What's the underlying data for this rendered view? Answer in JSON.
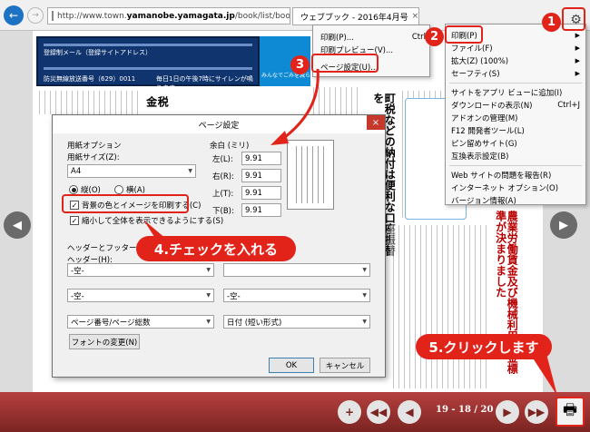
{
  "browser": {
    "url_prefix": "http://www.town.",
    "url_host": "yamanobe.yamagata.jp",
    "url_suffix": "/book/list/book19.",
    "tab_title": "ウェブブック - 2016年4月号",
    "tab_close": "×",
    "icons": [
      "back-arrow-icon",
      "forward-arrow-icon",
      "page-icon",
      "refresh-icon",
      "gear-icon"
    ]
  },
  "document": {
    "header_text1": "登録制メール（登録サイトアドレス）",
    "header_text2": "防災無線放送番号（629）0011",
    "header_text3": "毎日1日の午後7時にサイレンが鳴ります",
    "header_text4": "みんなでごみを減らしましょう！",
    "vertical_title": "町税などの納付は便利な口座振替を",
    "vertical_red": "農業労働賃金及び機械利用料金標準が決まりました",
    "side_text": "税金"
  },
  "print_menu": {
    "print": "印刷(P)...",
    "print_shortcut": "Ctrl",
    "preview": "印刷プレビュー(V)...",
    "page_setup": "ページ設定(U)..."
  },
  "gear_menu": {
    "items": [
      {
        "label": "印刷(P)",
        "shortcut": "",
        "submenu": true
      },
      {
        "label": "ファイル(F)",
        "shortcut": "",
        "submenu": true
      },
      {
        "label": "拡大(Z) (100%)",
        "shortcut": "",
        "submenu": true
      },
      {
        "label": "セーフティ(S)",
        "shortcut": "",
        "submenu": true
      },
      {
        "label": "サイトをアプリ ビューに追加(I)",
        "shortcut": "",
        "submenu": false
      },
      {
        "label": "ダウンロードの表示(N)",
        "shortcut": "Ctrl+J",
        "submenu": false
      },
      {
        "label": "アドオンの管理(M)",
        "shortcut": "",
        "submenu": false
      },
      {
        "label": "F12 開発者ツール(L)",
        "shortcut": "",
        "submenu": false
      },
      {
        "label": "ピン留めサイト(G)",
        "shortcut": "",
        "submenu": false
      },
      {
        "label": "互換表示設定(B)",
        "shortcut": "",
        "submenu": false
      },
      {
        "label": "Web サイトの問題を報告(R)",
        "shortcut": "",
        "submenu": false
      },
      {
        "label": "インターネット オプション(O)",
        "shortcut": "",
        "submenu": false
      },
      {
        "label": "バージョン情報(A)",
        "shortcut": "",
        "submenu": false
      }
    ]
  },
  "dialog": {
    "title": "ページ設定",
    "close": "×",
    "paper_options": "用紙オプション",
    "paper_size_label": "用紙サイズ(Z):",
    "paper_size_value": "A4",
    "portrait": "縦(O)",
    "landscape": "横(A)",
    "orientation": "portrait",
    "print_background": "背景の色とイメージを印刷する(C)",
    "print_background_checked": true,
    "shrink_to_fit": "縮小して全体を表示できるようにする(S)",
    "shrink_to_fit_checked": true,
    "margins_label": "余白 (ミリ)",
    "margin_left_label": "左(L):",
    "margin_right_label": "右(R):",
    "margin_top_label": "上(T):",
    "margin_bottom_label": "下(B):",
    "margin_left": "9.91",
    "margin_right": "9.91",
    "margin_top": "9.91",
    "margin_bottom": "9.91",
    "header_footer_label": "ヘッダーとフッター",
    "header_label": "ヘッダー(H):",
    "header_left": "-空-",
    "header_center": "",
    "header_right": "",
    "footer_label": "フッター(F):",
    "footer_left": "-空-",
    "footer_right": "-空-",
    "row3_left": "ページ番号/ページ総数",
    "row3_right": "日付 (短い形式)",
    "font_button": "フォントの変更(N)",
    "ok": "OK",
    "cancel": "キャンセル"
  },
  "toolbar": {
    "page_indicator": "19 - 18 / 20",
    "icons": [
      "add-icon",
      "first-page-icon",
      "prev-page-icon",
      "next-page-icon",
      "last-page-icon",
      "print-icon"
    ]
  },
  "annotations": {
    "step1": "1",
    "step2": "2",
    "step3": "3",
    "step4": "4.チェックを入れる",
    "step5": "5.クリックします"
  },
  "colors": {
    "annotation_red": "#e2231a",
    "toolbar_red": "#9a302e",
    "ie_blue": "#1e72c4"
  }
}
